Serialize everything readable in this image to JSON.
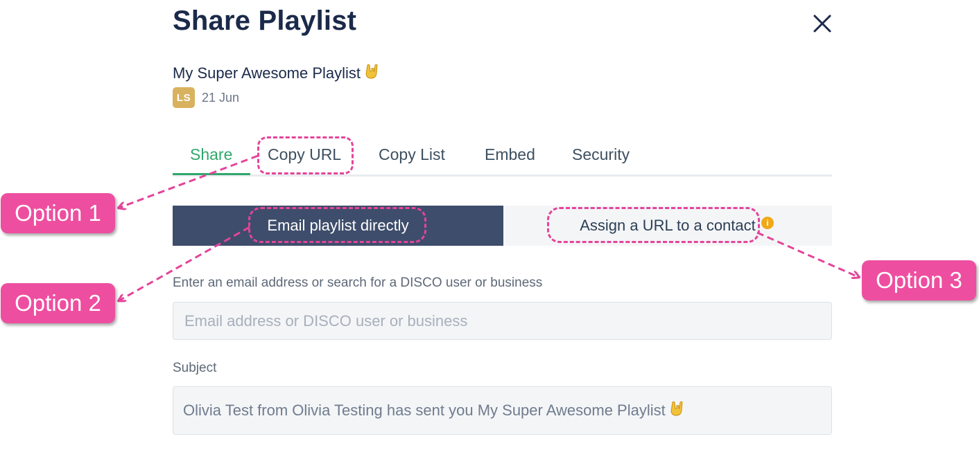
{
  "dialog": {
    "title": "Share Playlist",
    "close_icon": "close-icon"
  },
  "playlist": {
    "name": "My Super Awesome Playlist",
    "emoji_icon": "rock-hand-emoji-icon",
    "avatar_initials": "LS",
    "date": "21 Jun"
  },
  "tabs": [
    {
      "label": "Share",
      "active": true
    },
    {
      "label": "Copy URL",
      "active": false
    },
    {
      "label": "Copy List",
      "active": false
    },
    {
      "label": "Embed",
      "active": false
    },
    {
      "label": "Security",
      "active": false
    }
  ],
  "share_mode": {
    "email_label": "Email playlist directly",
    "assign_label": "Assign a URL to a contact",
    "info_icon": "info-icon",
    "info_glyph": "i"
  },
  "form": {
    "recipient_label": "Enter an email address or search for a DISCO user or business",
    "recipient_placeholder": "Email address or DISCO user or business",
    "subject_label": "Subject",
    "subject_value": "Olivia Test from Olivia Testing has sent you My Super Awesome Playlist"
  },
  "annotations": {
    "option1": "Option 1",
    "option2": "Option 2",
    "option3": "Option 3"
  },
  "colors": {
    "accent_green": "#2fa86b",
    "segment_dark": "#3e4d6b",
    "annotation_pink": "#ee4ea0",
    "avatar_gold": "#d9b25f",
    "info_orange": "#f0a818"
  }
}
